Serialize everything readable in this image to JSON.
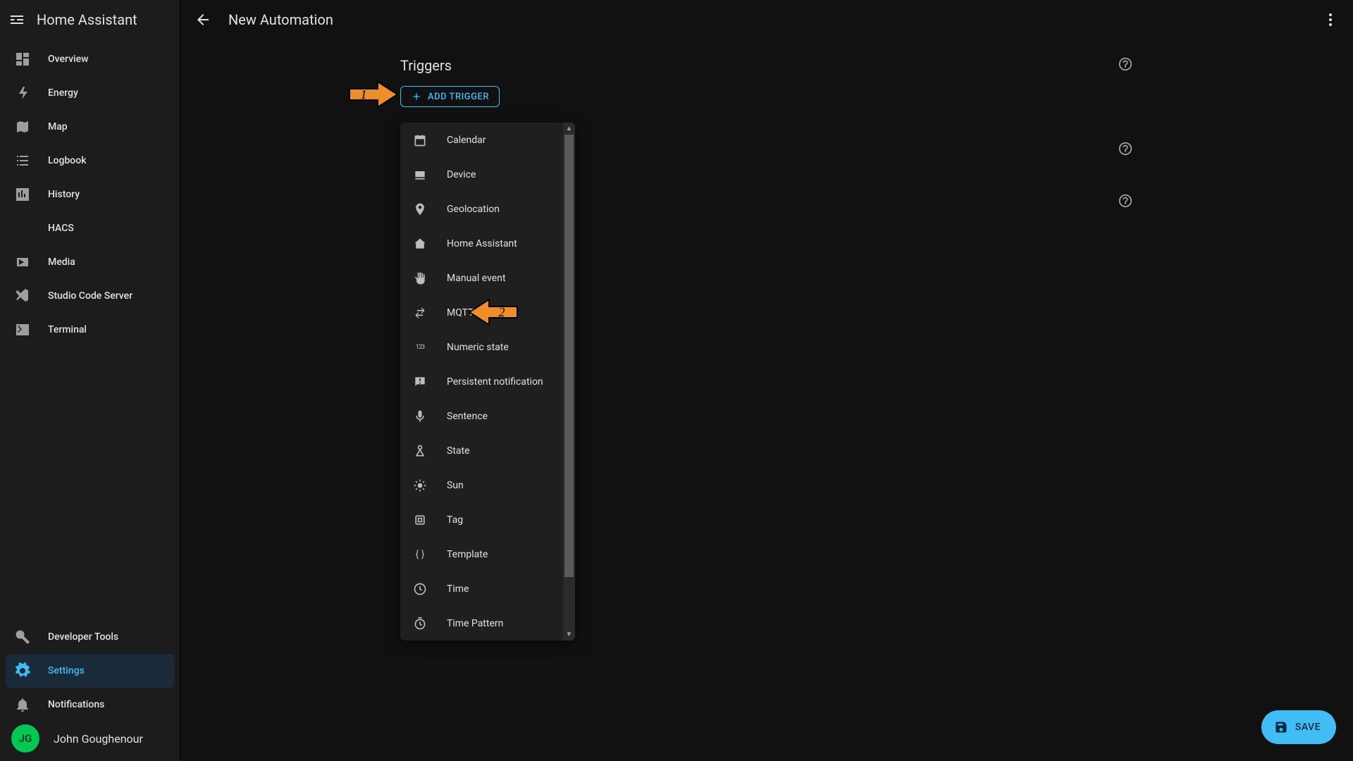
{
  "app": {
    "name": "Home Assistant"
  },
  "header": {
    "title": "New Automation"
  },
  "sidebar": {
    "items": [
      {
        "label": "Overview"
      },
      {
        "label": "Energy"
      },
      {
        "label": "Map"
      },
      {
        "label": "Logbook"
      },
      {
        "label": "History"
      },
      {
        "label": "HACS"
      },
      {
        "label": "Media"
      },
      {
        "label": "Studio Code Server"
      },
      {
        "label": "Terminal"
      }
    ],
    "bottom": [
      {
        "label": "Developer Tools"
      },
      {
        "label": "Settings"
      },
      {
        "label": "Notifications"
      }
    ],
    "user": {
      "initials": "JG",
      "name": "John Goughenour"
    }
  },
  "sections": [
    {
      "title": "Triggers",
      "addLabel": "Add Trigger"
    },
    {
      "title": ""
    },
    {
      "title": ""
    }
  ],
  "triggerMenu": {
    "items": [
      {
        "label": "Calendar"
      },
      {
        "label": "Device"
      },
      {
        "label": "Geolocation"
      },
      {
        "label": "Home Assistant"
      },
      {
        "label": "Manual event"
      },
      {
        "label": "MQTT"
      },
      {
        "label": "Numeric state"
      },
      {
        "label": "Persistent notification"
      },
      {
        "label": "Sentence"
      },
      {
        "label": "State"
      },
      {
        "label": "Sun"
      },
      {
        "label": "Tag"
      },
      {
        "label": "Template"
      },
      {
        "label": "Time"
      },
      {
        "label": "Time Pattern"
      }
    ]
  },
  "fab": {
    "label": "SAVE"
  },
  "annotations": {
    "step1": "1",
    "step2": "2"
  },
  "colors": {
    "accent": "#41bdf5",
    "annotation": "#ef8e27"
  }
}
